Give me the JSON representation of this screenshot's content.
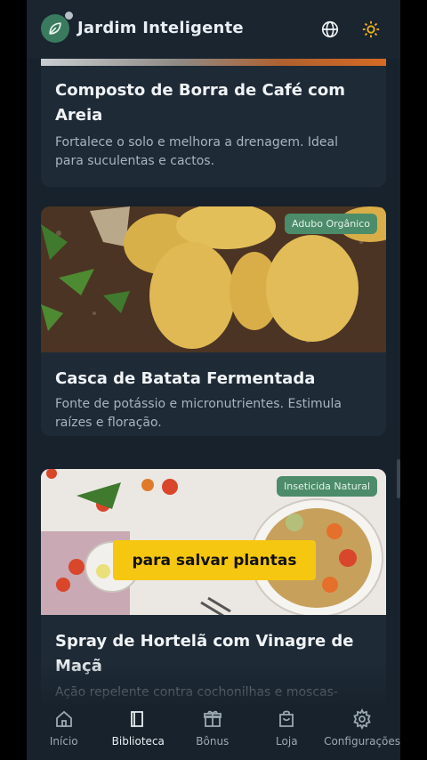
{
  "header": {
    "title": "Jardim Inteligente",
    "icons": [
      "leaf-icon",
      "globe-icon",
      "sun-icon"
    ]
  },
  "cards": [
    {
      "title": "Composto de Borra de Café com Areia",
      "description": "Fortalece o solo e melhora a drenagem. Ideal para suculentas e cactos."
    },
    {
      "badge": "Adubo Orgânico",
      "title": "Casca de Batata Fermentada",
      "description": "Fonte de potássio e micronutrientes. Estimula raízes e floração."
    },
    {
      "badge": "Inseticida Natural",
      "title": "Spray de Hortelã com Vinagre de Maçã",
      "description": "Ação repelente contra cochonilhas e moscas-"
    }
  ],
  "video_caption": "para salvar plantas",
  "nav": [
    {
      "label": "Início",
      "icon": "home-icon"
    },
    {
      "label": "Biblioteca",
      "icon": "book-icon"
    },
    {
      "label": "Bônus",
      "icon": "gift-icon"
    },
    {
      "label": "Loja",
      "icon": "shopping-bag-icon"
    },
    {
      "label": "Configurações",
      "icon": "gear-icon"
    }
  ],
  "colors": {
    "background": "#17222c",
    "card": "#1e2a36",
    "badge": "#4c8c6a",
    "caption": "#f6c710",
    "sun_icon": "#f2b318"
  }
}
